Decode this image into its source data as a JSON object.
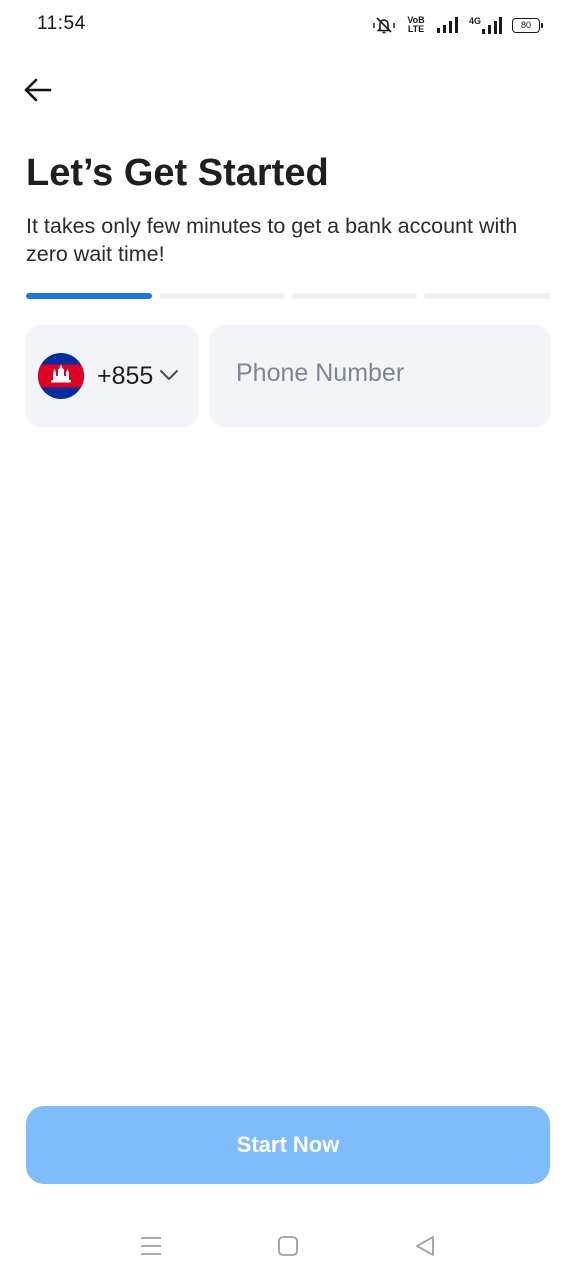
{
  "status_bar": {
    "time": "11:54",
    "volte_top": "VoB",
    "volte_bottom": "LTE",
    "network": "4G",
    "battery": "80",
    "icons": [
      "vibrate-mute-icon",
      "volte-icon",
      "signal-icon",
      "data-signal-icon",
      "battery-icon"
    ]
  },
  "header": {
    "back_icon": "arrow-left-icon"
  },
  "content": {
    "title": "Let’s Get Started",
    "subtitle": "It takes only few minutes to get a bank account with zero wait time!",
    "progress": {
      "total_steps": 4,
      "current_step": 1
    }
  },
  "phone": {
    "country_code": "+855",
    "country_flag": "cambodia-flag-icon",
    "placeholder": "Phone Number",
    "value": ""
  },
  "cta": {
    "label": "Start Now"
  },
  "nav_bar": {
    "icons": [
      "menu-icon",
      "home-icon",
      "back-triangle-icon"
    ]
  },
  "colors": {
    "accent": "#1c78e0",
    "button_disabled": "#7fbcfb",
    "field_bg": "#f3f4f7",
    "progress_inactive": "#eef0f4"
  }
}
